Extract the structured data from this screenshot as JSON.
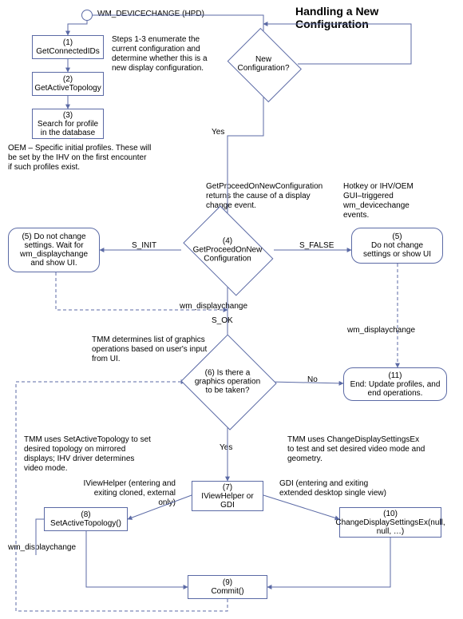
{
  "title": "Handling a New Configuration",
  "start": {
    "label": "WM_DEVICECHANGE (HPD)"
  },
  "nodes": {
    "n1": {
      "label": "(1)\nGetConnectedIDs"
    },
    "n2": {
      "label": "(2)\nGetActiveTopology"
    },
    "n3": {
      "label": "(3)\nSearch for profile in the database"
    },
    "dNew": {
      "label": "New Configuration?"
    },
    "n4": {
      "label": "(4)\nGetProceedOnNew Configuration"
    },
    "n5L": {
      "label": "(5) Do not change settings. Wait for wm_displaychange and show UI."
    },
    "n5R": {
      "label": "(5)\nDo not change settings or show UI"
    },
    "n6": {
      "label": "(6)\nIs there a graphics operation to be taken?"
    },
    "n7": {
      "label": "(7)\nIViewHelper or GDI"
    },
    "n8": {
      "label": "(8)\nSetActiveTopology()"
    },
    "n9": {
      "label": "(9)\nCommit()"
    },
    "n10": {
      "label": "(10)\nChangeDisplaySettingsEx(null, null, …)"
    },
    "n11": {
      "label": "(11)\nEnd:  Update profiles, and end operations."
    }
  },
  "annotations": {
    "a_steps": "Steps 1-3 enumerate the current configuration and determine whether this is a new display configuration.",
    "a_oem": "OEM – Specific initial profiles. These will be set by the IHV on the first encounter if such profiles exist.",
    "a_cause": "GetProceedOnNewConfiguration returns the cause of a display change event.",
    "a_hotkey": "Hotkey or IHV/OEM GUI–triggered wm_devicechange events.",
    "a_tmm6": "TMM determines list of graphics operations based on user's input from UI.",
    "a_tmm8": "TMM uses SetActiveTopology to set desired topology on mirrored displays; IHV driver determines video mode.",
    "a_tmm10": "TMM uses ChangeDisplaySettingsEx to test and set desired video mode and geometry.",
    "a_iview": "IViewHelper (entering and exiting cloned, external only)",
    "a_gdi": "GDI (entering and exiting extended desktop single view)"
  },
  "edges": {
    "yes": "Yes",
    "no": "No",
    "s_init": "S_INIT",
    "s_false": "S_FALSE",
    "s_ok": "S_OK",
    "wm_dc": "wm_displaychange"
  }
}
